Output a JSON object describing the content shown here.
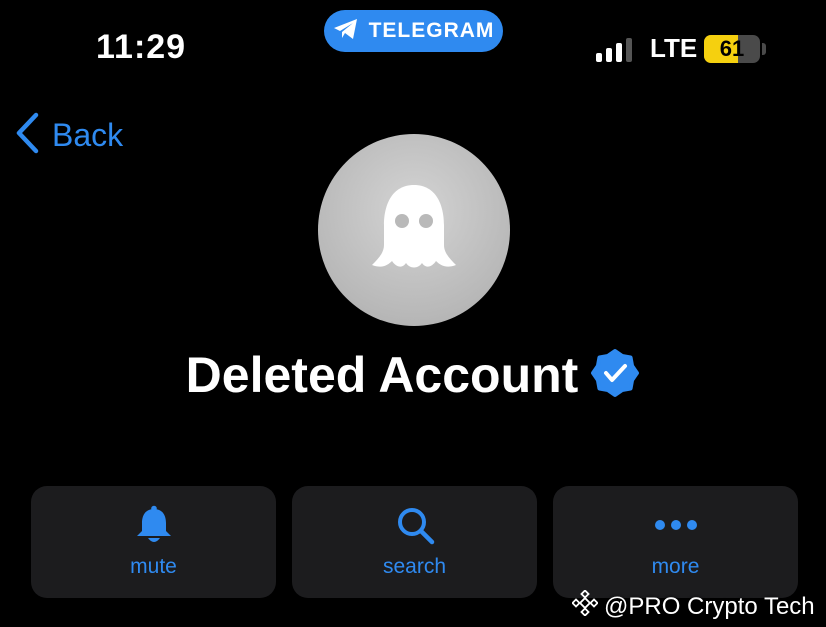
{
  "status_bar": {
    "time": "11:29",
    "app_pill": {
      "label": "TELEGRAM",
      "icon": "telegram-icon",
      "color": "#2f8af0"
    },
    "signal_levels": 4,
    "signal_active": 3,
    "network": "LTE",
    "battery": {
      "percent": 61,
      "label": "61",
      "color": "#f5d00f"
    }
  },
  "nav": {
    "back_label": "Back",
    "back_icon": "chevron-left-icon"
  },
  "profile": {
    "name": "Deleted Account",
    "avatar_icon": "ghost-icon",
    "verified_icon": "verified-badge-icon",
    "accent_color": "#2f8af0"
  },
  "actions": [
    {
      "id": "mute",
      "label": "mute",
      "icon": "bell-icon"
    },
    {
      "id": "search",
      "label": "search",
      "icon": "search-icon"
    },
    {
      "id": "more",
      "label": "more",
      "icon": "more-dots-icon"
    }
  ],
  "watermark": {
    "text": "@PRO Crypto Tech",
    "icon": "binance-logo-icon"
  }
}
